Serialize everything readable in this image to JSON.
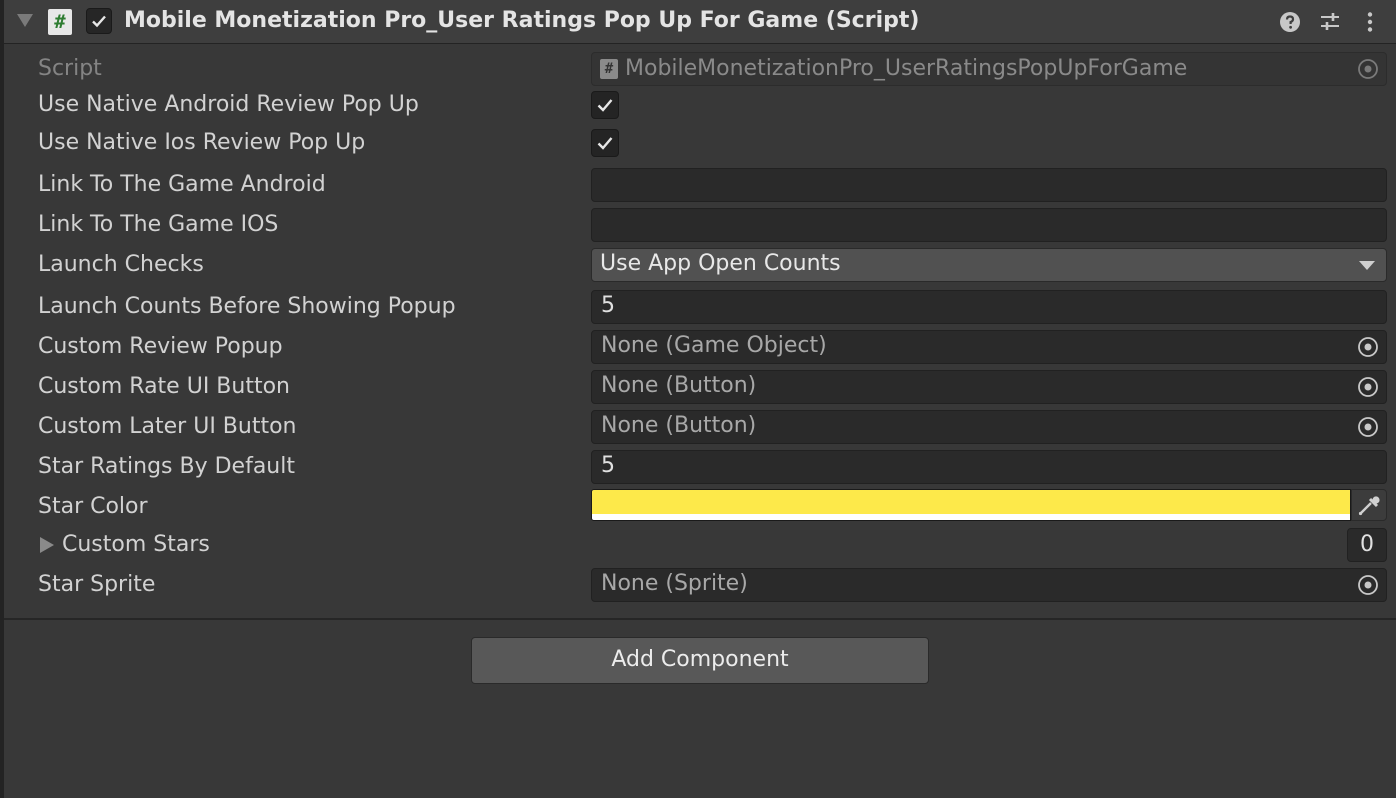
{
  "component": {
    "title": "Mobile Monetization Pro_User Ratings Pop Up For Game (Script)",
    "script_icon": "#",
    "enabled": true
  },
  "script_field": {
    "label": "Script",
    "value": "MobileMonetizationPro_UserRatingsPopUpForGame",
    "icon": "#"
  },
  "fields": {
    "native_android": {
      "label": "Use Native Android Review Pop Up",
      "checked": true
    },
    "native_ios": {
      "label": "Use Native Ios Review Pop Up",
      "checked": true
    },
    "link_android": {
      "label": "Link To The Game Android",
      "value": ""
    },
    "link_ios": {
      "label": "Link To The Game IOS",
      "value": ""
    },
    "launch_checks": {
      "label": "Launch Checks",
      "value": "Use App Open Counts"
    },
    "launch_counts": {
      "label": "Launch Counts Before Showing Popup",
      "value": "5"
    },
    "custom_review_popup": {
      "label": "Custom Review Popup",
      "value": "None (Game Object)"
    },
    "custom_rate_button": {
      "label": "Custom Rate UI Button",
      "value": "None (Button)"
    },
    "custom_later_button": {
      "label": "Custom Later UI Button",
      "value": "None (Button)"
    },
    "star_ratings_default": {
      "label": "Star Ratings By Default",
      "value": "5"
    },
    "star_color": {
      "label": "Star Color",
      "color": "#fde94a",
      "alpha_color": "#ffffff"
    },
    "custom_stars": {
      "label": "Custom Stars",
      "size": "0"
    },
    "star_sprite": {
      "label": "Star Sprite",
      "value": "None (Sprite)"
    }
  },
  "add_component": {
    "label": "Add Component"
  },
  "icons": {
    "foldout": "triangle-down-icon",
    "help": "help-icon",
    "presets": "sliders-icon",
    "menu": "kebab-menu-icon",
    "object_picker": "object-picker-icon",
    "eyedropper": "eyedropper-icon"
  }
}
